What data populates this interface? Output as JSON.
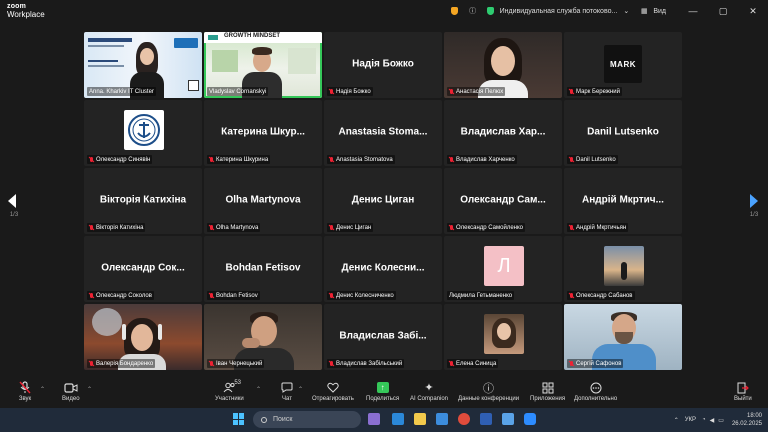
{
  "app": {
    "logo_line1": "zoom",
    "logo_line2": "Workplace",
    "meeting_title": "Индивидуальная служба потоково...",
    "view_label": "Вид"
  },
  "colors": {
    "background": "#1a1a1a",
    "tile": "#232323",
    "active_speaker": "#35c759",
    "muted": "#ee2233",
    "nav_arrow": "#4ba3ff"
  },
  "gallery": {
    "page_left": "1/3",
    "page_right": "1/3",
    "tiles": [
      {
        "display": "",
        "label": "Anna. Kharkiv IT Cluster"
      },
      {
        "display": "GROWTH MINDSET",
        "label": "Vladyslav Cornanskyi"
      },
      {
        "display": "Надія Божко",
        "label": "Надія Божко"
      },
      {
        "display": "",
        "label": "Анастасія Пелюх"
      },
      {
        "display": "MARK",
        "label": "Марк Бережний"
      },
      {
        "display": "",
        "label": "Олександр Синявін"
      },
      {
        "display": "Катерина Шкур...",
        "label": "Катерина Шкурина"
      },
      {
        "display": "Anastasia Stoma...",
        "label": "Anastasia Stomatova"
      },
      {
        "display": "Владислав Хар...",
        "label": "Владислав Харченко"
      },
      {
        "display": "Danil Lutsenko",
        "label": "Danil Lutsenko"
      },
      {
        "display": "Вікторія Катихіна",
        "label": "Вікторія Катихіна"
      },
      {
        "display": "Olha Martynova",
        "label": "Olha Martynova"
      },
      {
        "display": "Денис Циган",
        "label": "Денис Циган"
      },
      {
        "display": "Олександр Сам...",
        "label": "Олександр Самойленко"
      },
      {
        "display": "Андрій Мкртич...",
        "label": "Андрій Мкртичьян"
      },
      {
        "display": "Олександр Сок...",
        "label": "Олександр Соколов"
      },
      {
        "display": "Bohdan Fetisov",
        "label": "Bohdan Fetisov"
      },
      {
        "display": "Денис Колесни...",
        "label": "Денис Колесниченко"
      },
      {
        "display": "Л",
        "label": "Людмила Гетьманенко"
      },
      {
        "display": "",
        "label": "Олександр Сабанов"
      },
      {
        "display": "",
        "label": "Валерія Бондаренко"
      },
      {
        "display": "",
        "label": "Іван Чернецький"
      },
      {
        "display": "Владислав Забі...",
        "label": "Владислав Забільський"
      },
      {
        "display": "",
        "label": "Елена Синица"
      },
      {
        "display": "",
        "label": "Сергій Сафонов"
      }
    ]
  },
  "toolbar": {
    "mic": "Звук",
    "video": "Видео",
    "participants": "Участники",
    "participants_count": "53",
    "chat": "Чат",
    "react": "Отреагировать",
    "share": "Поделиться",
    "ai": "AI Companion",
    "info": "Данные конференции",
    "apps": "Приложения",
    "more": "Дополнительно",
    "leave": "Выйти"
  },
  "taskbar": {
    "search_placeholder": "Поиск",
    "lang": "УКР",
    "time": "18:00",
    "date": "26.02.2025"
  }
}
